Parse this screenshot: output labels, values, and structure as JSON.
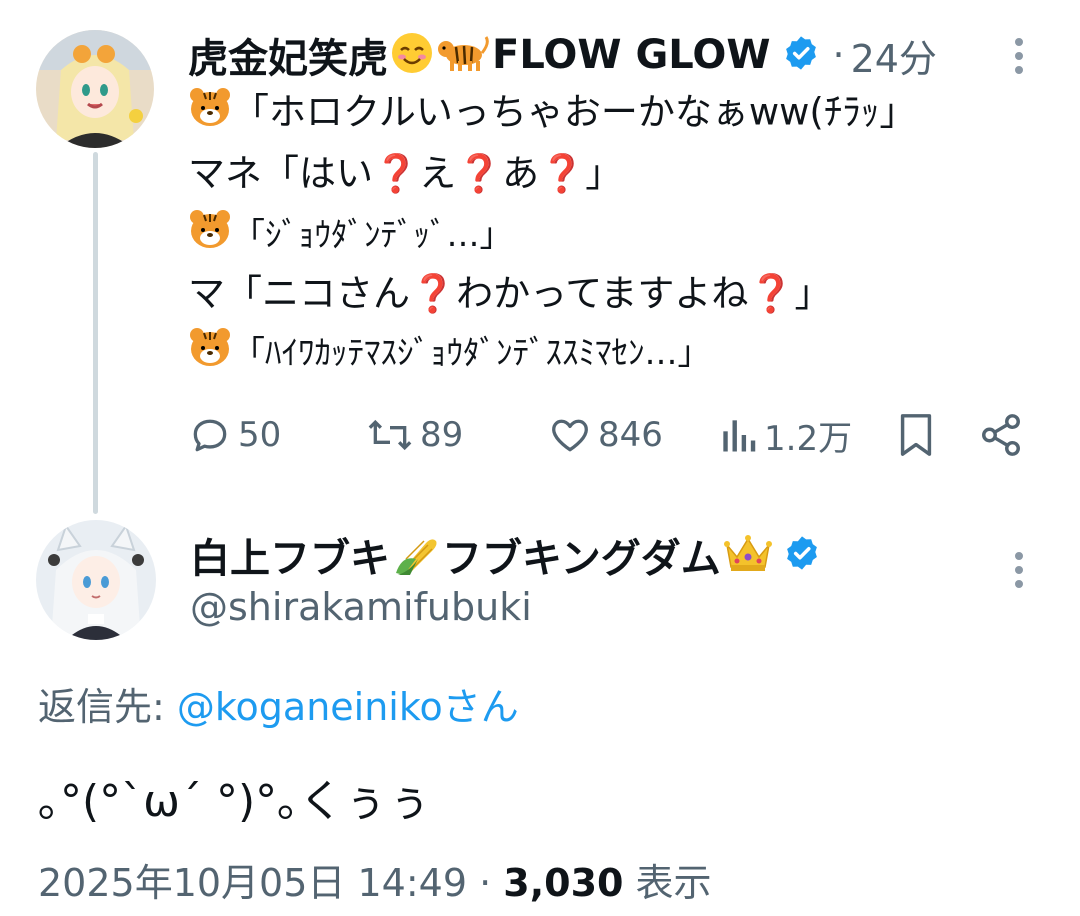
{
  "tweet1": {
    "author_name": "虎金妃笑虎",
    "author_suffix": "FLOW GLOW",
    "time": "24分",
    "lines": [
      "「ホロクルいっちゃおーかなぁww(ﾁﾗｯ」",
      "マネ「はい❓え❓あ❓」",
      "「ｼﾞｮｳﾀﾞﾝﾃﾞｯﾞ…」",
      "マ「ニコさん❓わかってますよね❓」",
      "「ﾊｲﾜｶｯﾃﾏｽｼﾞｮｳﾀﾞﾝﾃﾞｽｽﾐﾏｾﾝ…」"
    ],
    "replies": "50",
    "reposts": "89",
    "likes": "846",
    "views": "1.2万"
  },
  "tweet2": {
    "author_name": "白上フブキ",
    "author_suffix": "フブキングダム",
    "handle": "@shirakamifubuki",
    "reply_prefix": "返信先: ",
    "reply_target": "@koganeinikoさん",
    "text": "｡°(°`ω´ °)°｡くぅぅ",
    "date": "2025年10月05日 14:49 · ",
    "view_count": "3,030",
    "view_label": " 表示"
  },
  "colors": {
    "accent": "#1d9bf0",
    "muted": "#536471",
    "text": "#0f1419",
    "line": "#cfd9de"
  },
  "icons": [
    "verified-badge-icon",
    "more-icon",
    "reply-icon",
    "repost-icon",
    "like-icon",
    "views-icon",
    "bookmark-icon",
    "share-icon",
    "tiger-emoji",
    "smile-emoji",
    "corn-emoji",
    "crown-emoji"
  ]
}
